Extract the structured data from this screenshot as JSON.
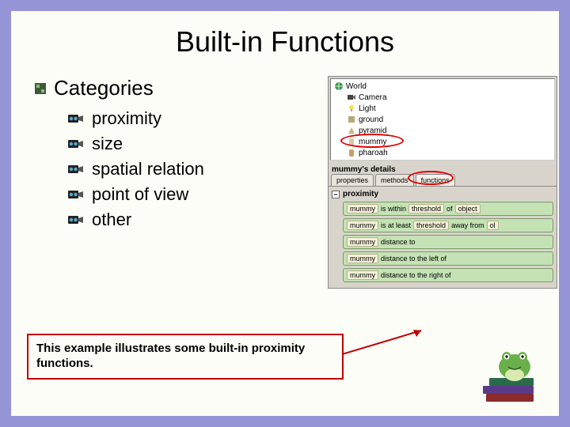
{
  "title": "Built-in Functions",
  "heading": "Categories",
  "items": [
    "proximity",
    "size",
    "spatial relation",
    "point of view",
    "other"
  ],
  "tree": {
    "root": "World",
    "nodes": [
      "Camera",
      "Light",
      "ground",
      "pyramid",
      "mummy",
      "pharoah"
    ]
  },
  "details_header": "mummy's details",
  "tabs": [
    "properties",
    "methods",
    "functions"
  ],
  "group_label": "proximity",
  "tiles": [
    [
      "mummy",
      "is within",
      "threshold",
      "of",
      "object"
    ],
    [
      "mummy",
      "is at least",
      "threshold",
      "away from",
      "ol"
    ],
    [
      "mummy",
      "distance to"
    ],
    [
      "mummy",
      "distance to the left of"
    ],
    [
      "mummy",
      "distance to the right of"
    ]
  ],
  "callout": "This example illustrates some built-in proximity functions."
}
